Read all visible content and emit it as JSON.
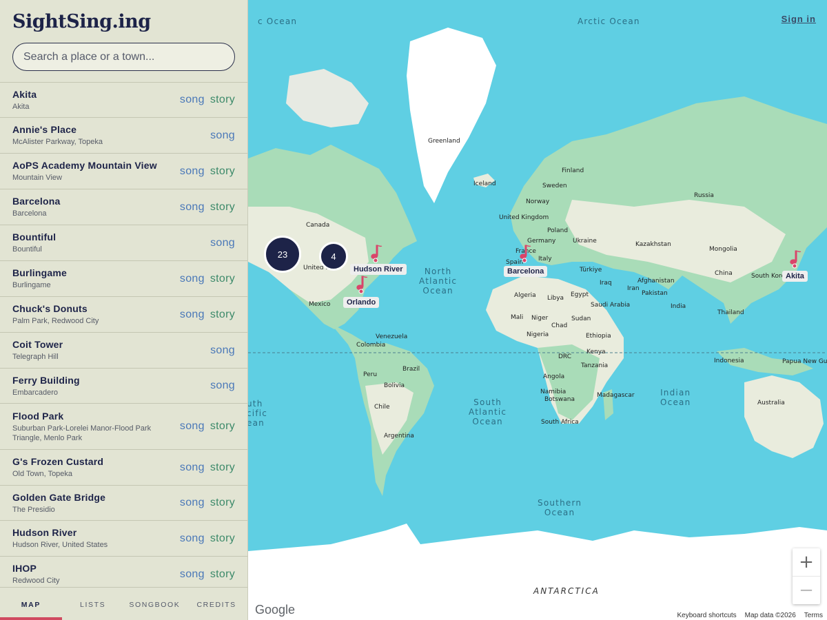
{
  "app": {
    "title": "SightSing.ing"
  },
  "search": {
    "placeholder": "Search a place or a town..."
  },
  "places": [
    {
      "name": "Akita",
      "sub": "Akita",
      "links": [
        "song",
        "story"
      ]
    },
    {
      "name": "Annie's Place",
      "sub": "McAlister Parkway, Topeka",
      "links": [
        "song"
      ]
    },
    {
      "name": "AoPS Academy Mountain View",
      "sub": "Mountain View",
      "links": [
        "song",
        "story"
      ]
    },
    {
      "name": "Barcelona",
      "sub": "Barcelona",
      "links": [
        "song",
        "story"
      ]
    },
    {
      "name": "Bountiful",
      "sub": "Bountiful",
      "links": [
        "song"
      ]
    },
    {
      "name": "Burlingame",
      "sub": "Burlingame",
      "links": [
        "song",
        "story"
      ]
    },
    {
      "name": "Chuck's Donuts",
      "sub": "Palm Park, Redwood City",
      "links": [
        "song",
        "story"
      ]
    },
    {
      "name": "Coit Tower",
      "sub": "Telegraph Hill",
      "links": [
        "song"
      ]
    },
    {
      "name": "Ferry Building",
      "sub": "Embarcadero",
      "links": [
        "song"
      ]
    },
    {
      "name": "Flood Park",
      "sub": "Suburban Park-Lorelei Manor-Flood Park Triangle, Menlo Park",
      "links": [
        "song",
        "story"
      ]
    },
    {
      "name": "G's Frozen Custard",
      "sub": "Old Town, Topeka",
      "links": [
        "song",
        "story"
      ]
    },
    {
      "name": "Golden Gate Bridge",
      "sub": "The Presidio",
      "links": [
        "song",
        "story"
      ]
    },
    {
      "name": "Hudson River",
      "sub": "Hudson River, United States",
      "links": [
        "song",
        "story"
      ]
    },
    {
      "name": "IHOP",
      "sub": "Redwood City",
      "links": [
        "song",
        "story"
      ]
    }
  ],
  "nav": {
    "tabs": [
      "MAP",
      "LISTS",
      "SONGBOOK",
      "CREDITS"
    ],
    "active": "MAP"
  },
  "map": {
    "signin": "Sign in",
    "clusters": [
      {
        "count": "23"
      },
      {
        "count": "4"
      }
    ],
    "pins": [
      "Hudson River",
      "Orlando",
      "Barcelona",
      "Akita"
    ],
    "oceans": {
      "arctic_left": "c Ocean",
      "arctic": "Arctic Ocean",
      "north_atlantic": "North\nAtlantic\nOcean",
      "south_atlantic": "South\nAtlantic\nOcean",
      "south_pacific": "uth\ncific\nean",
      "indian": "Indian\nOcean",
      "southern": "Southern\nOcean",
      "antarctica": "ANTARCTICA"
    },
    "labels": [
      "Greenland",
      "Iceland",
      "Finland",
      "Sweden",
      "Norway",
      "Russia",
      "United Kingdom",
      "Poland",
      "Germany",
      "Ukraine",
      "France",
      "Italy",
      "Spain",
      "Kazakhstan",
      "Mongolia",
      "Türkiye",
      "Iraq",
      "Iran",
      "Afghanistan",
      "Pakistan",
      "China",
      "South Korea",
      "India",
      "Thailand",
      "Indonesia",
      "Papua New Guinea",
      "Australia",
      "Algeria",
      "Libya",
      "Egypt",
      "Saudi Arabia",
      "Mali",
      "Niger",
      "Chad",
      "Sudan",
      "Nigeria",
      "Ethiopia",
      "Kenya",
      "DRC",
      "Tanzania",
      "Angola",
      "Namibia",
      "Botswana",
      "Madagascar",
      "South Africa",
      "Canada",
      "United S",
      "Mexico",
      "Venezuela",
      "Colombia",
      "Peru",
      "Brazil",
      "Bolivia",
      "Chile",
      "Argentina"
    ],
    "zoom_in": "+",
    "zoom_out": "−",
    "google": "Google",
    "attribution": [
      "Keyboard shortcuts",
      "Map data ©2026",
      "Terms"
    ]
  }
}
